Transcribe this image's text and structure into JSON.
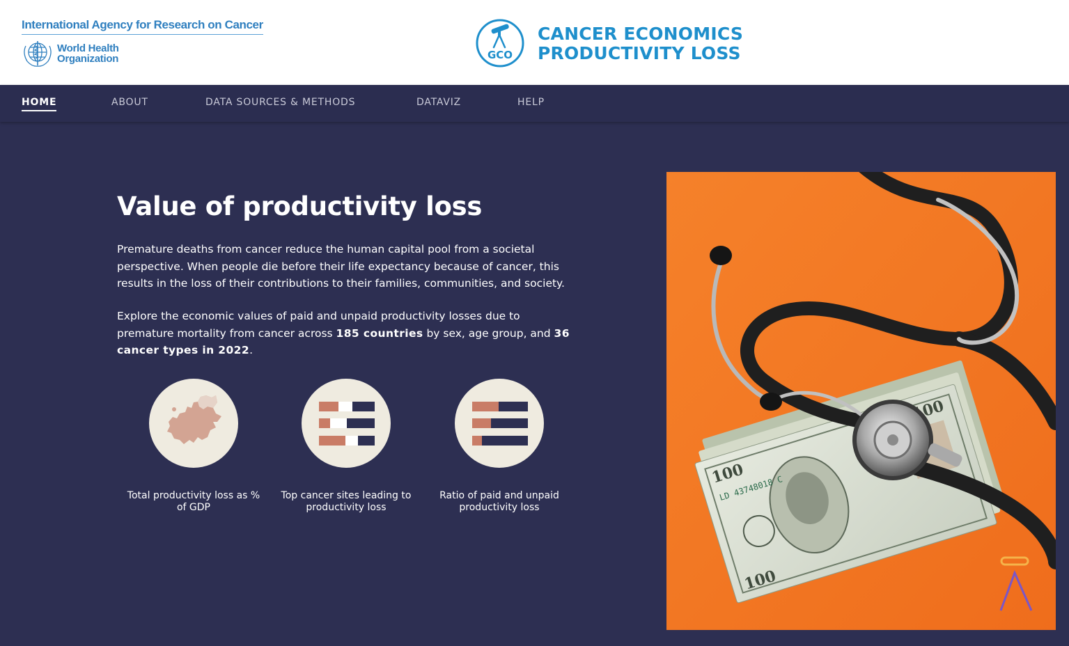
{
  "header": {
    "iarc_name": "International Agency for Research on Cancer",
    "who_line1": "World Health",
    "who_line2": "Organization",
    "logo_text": "GCO",
    "title_line1": "CANCER ECONOMICS",
    "title_line2": "PRODUCTIVITY LOSS"
  },
  "nav": {
    "items": [
      {
        "label": "HOME",
        "active": true
      },
      {
        "label": "ABOUT"
      },
      {
        "label": "DATA SOURCES & METHODS"
      },
      {
        "label": "DATAVIZ"
      },
      {
        "label": "HELP"
      }
    ]
  },
  "main": {
    "title": "Value of productivity loss",
    "para1": "Premature deaths from cancer reduce the human capital pool from a societal perspective. When people die before their life expectancy because of cancer, this results in the loss of their contributions to their families, communities, and society.",
    "para2_part1": "Explore the economic values of paid and unpaid productivity losses due to premature mortality from cancer across ",
    "para2_bold1": "185 countries",
    "para2_part2": " by sex, age group, and ",
    "para2_bold2": "36 cancer types in 2022",
    "para2_part3": ".",
    "cards": [
      {
        "label": "Total productivity loss as % of GDP",
        "icon": "europe-map-icon"
      },
      {
        "label": "Top cancer sites leading to productivity loss",
        "icon": "bar-ranking-icon"
      },
      {
        "label": "Ratio of paid and unpaid productivity loss",
        "icon": "ratio-bars-icon"
      }
    ]
  },
  "photo": {
    "subject": "stethoscope-on-dollar-bills-image",
    "bill_text": "LD 43748018 C"
  },
  "colors": {
    "nav_bg": "#2b2d50",
    "page_bg": "#2d2f52",
    "brand_blue": "#1e8fcc",
    "accent_salmon": "#c97c66",
    "card_circle": "#efebe0",
    "photo_bg": "#f07a22"
  }
}
